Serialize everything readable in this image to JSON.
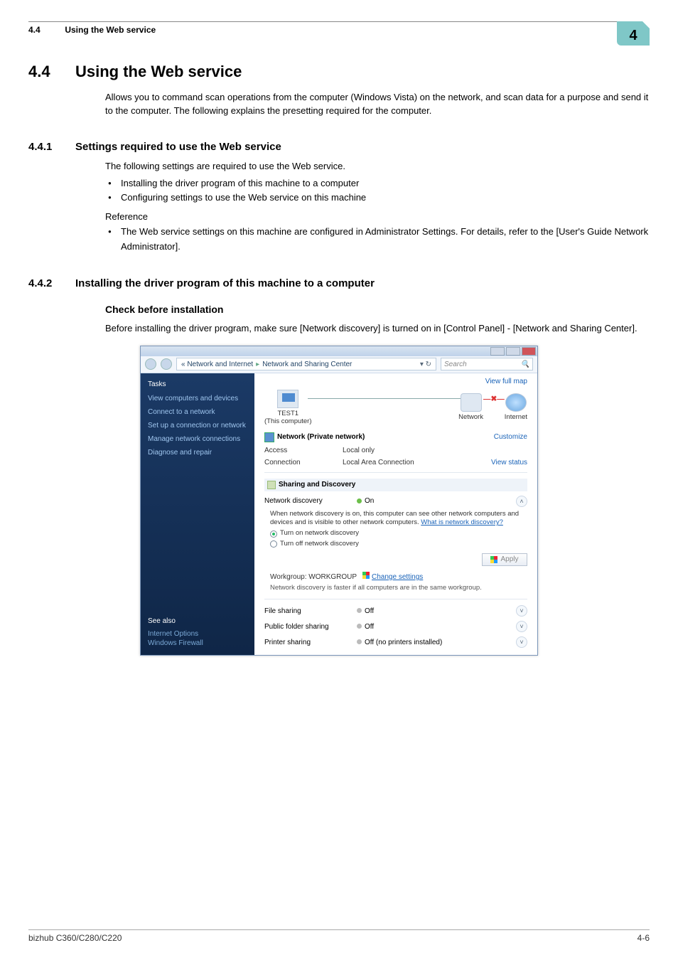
{
  "header": {
    "section_num": "4.4",
    "section_title": "Using the Web service",
    "badge": "4"
  },
  "h1": {
    "num": "4.4",
    "title": "Using the Web service"
  },
  "intro": "Allows you to command scan operations from the computer (Windows Vista) on the network, and scan data for a purpose and send it to the computer. The following explains the presetting required for the computer.",
  "s441": {
    "num": "4.4.1",
    "title": "Settings required to use the Web service",
    "lead": "The following settings are required to use the Web service.",
    "b1": "Installing the driver program of this machine to a computer",
    "b2": "Configuring settings to use the Web service on this machine",
    "ref_label": "Reference",
    "ref_b1": "The Web service settings on this machine are configured in Administrator Settings. For details, refer to the [User's Guide Network Administrator]."
  },
  "s442": {
    "num": "4.4.2",
    "title": "Installing the driver program of this machine to a computer",
    "h3": "Check before installation",
    "lead": "Before installing the driver program, make sure [Network discovery] is turned on in [Control Panel] - [Network and Sharing Center]."
  },
  "vista": {
    "crumb_pre": "«  Network and Internet",
    "crumb_cur": "Network and Sharing Center",
    "search_placeholder": "Search",
    "tasks_hd": "Tasks",
    "task1": "View computers and devices",
    "task2": "Connect to a network",
    "task3": "Set up a connection or network",
    "task4": "Manage network connections",
    "task5": "Diagnose and repair",
    "see_also": "See also",
    "sa1": "Internet Options",
    "sa2": "Windows Firewall",
    "view_full_map": "View full map",
    "node_pc_name": "TEST1",
    "node_pc_sub": "(This computer)",
    "node_net": "Network",
    "node_inet": "Internet",
    "net_label": "Network (Private network)",
    "customize": "Customize",
    "access_k": "Access",
    "access_v": "Local only",
    "conn_k": "Connection",
    "conn_v": "Local Area Connection",
    "view_status": "View status",
    "shd": "Sharing and Discovery",
    "nd_k": "Network discovery",
    "nd_v": "On",
    "nd_desc": "When network discovery is on, this computer can see other network computers and devices and is visible to other network computers. ",
    "nd_link": "What is network discovery?",
    "nd_r1": "Turn on network discovery",
    "nd_r2": "Turn off network discovery",
    "apply": "Apply",
    "wg_label": "Workgroup: WORKGROUP",
    "wg_change": "Change settings",
    "wg_note": "Network discovery is faster if all computers are in the same workgroup.",
    "fs_k": "File sharing",
    "fs_v": "Off",
    "pfs_k": "Public folder sharing",
    "pfs_v": "Off",
    "ps_k": "Printer sharing",
    "ps_v": "Off (no printers installed)"
  },
  "footer": {
    "left": "bizhub C360/C280/C220",
    "right": "4-6"
  }
}
